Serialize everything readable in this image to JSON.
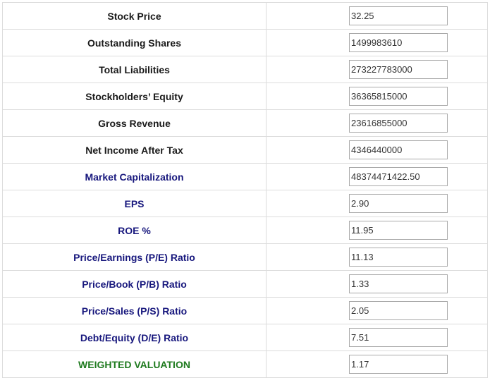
{
  "colors": {
    "input_label": "#1a1a1a",
    "output_label": "#17177d",
    "final_label": "#1e7a1e",
    "border": "#dcdcdc"
  },
  "rows": [
    {
      "label": "Stock Price",
      "value": "32.25"
    },
    {
      "label": "Outstanding Shares",
      "value": "1499983610"
    },
    {
      "label": "Total Liabilities",
      "value": "273227783000"
    },
    {
      "label": "Stockholders’ Equity",
      "value": "36365815000"
    },
    {
      "label": "Gross Revenue",
      "value": "23616855000"
    },
    {
      "label": "Net Income After Tax",
      "value": "4346440000"
    },
    {
      "label": "Market Capitalization",
      "value": "48374471422.50"
    },
    {
      "label": "EPS",
      "value": "2.90"
    },
    {
      "label": "ROE %",
      "value": "11.95"
    },
    {
      "label": "Price/Earnings (P/E) Ratio",
      "value": "11.13"
    },
    {
      "label": "Price/Book (P/B) Ratio",
      "value": "1.33"
    },
    {
      "label": "Price/Sales (P/S) Ratio",
      "value": "2.05"
    },
    {
      "label": "Debt/Equity (D/E) Ratio",
      "value": "7.51"
    },
    {
      "label": "WEIGHTED VALUATION",
      "value": "1.17"
    }
  ]
}
